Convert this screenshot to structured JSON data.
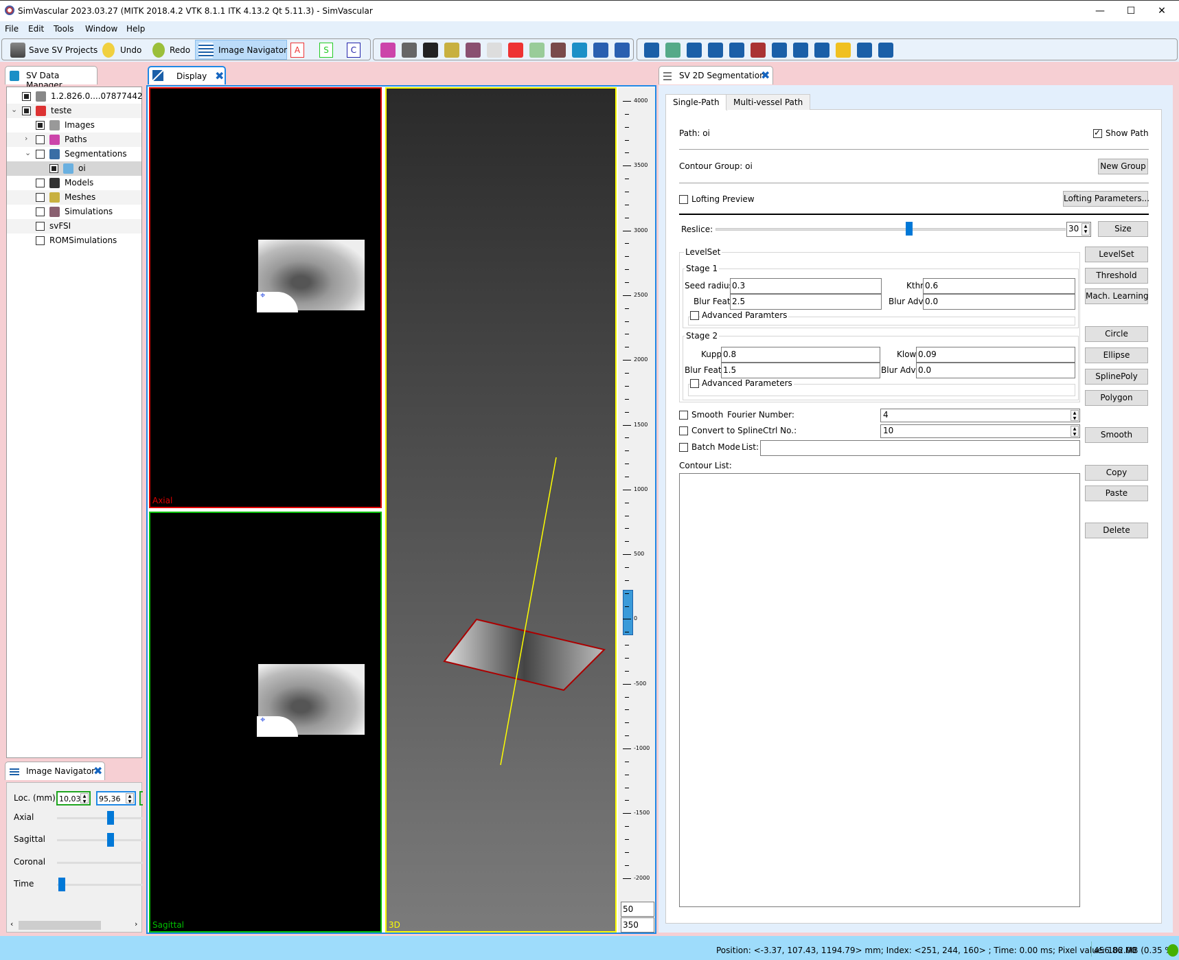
{
  "window": {
    "title": "SimVascular 2023.03.27 (MITK 2018.4.2 VTK 8.1.1 ITK 4.13.2 Qt 5.11.3) - SimVascular",
    "minimize": "—",
    "maximize": "☐",
    "close": "✕"
  },
  "menu": [
    "File",
    "Edit",
    "Tools",
    "Window",
    "Help"
  ],
  "toolbar": {
    "save": "Save SV Projects",
    "undo": "Undo",
    "redo": "Redo",
    "image_navigator": "Image Navigator",
    "axial": "A",
    "sagittal": "S",
    "coronal": "C",
    "tools": [
      "path-icon",
      "segmentation-icon",
      "model-icon",
      "mesh-icon",
      "simulation-icon",
      "branch-icon",
      "color-map-icon",
      "surface-icon",
      "texture-icon",
      "database-icon",
      "pen-icon",
      "wrench-icon",
      "archive-icon",
      "pointset-icon",
      "help-icon",
      "settings-icon",
      "zoom-icon",
      "measure-icon",
      "list-icon",
      "tools-icon",
      "table-icon",
      "python-icon",
      "chart-icon",
      "eye-icon"
    ]
  },
  "data_manager": {
    "tab": "SV Data Manager",
    "items": [
      {
        "label": "1.2.826.0....07877442",
        "checked": "filled",
        "indent": 0
      },
      {
        "label": "teste",
        "checked": "filled",
        "indent": 0,
        "expand": "open"
      },
      {
        "label": "Images",
        "checked": "filled",
        "indent": 1
      },
      {
        "label": "Paths",
        "checked": "empty",
        "indent": 1,
        "expand": "closed"
      },
      {
        "label": "Segmentations",
        "checked": "empty",
        "indent": 1,
        "expand": "open"
      },
      {
        "label": "oi",
        "checked": "filled",
        "indent": 2,
        "selected": true
      },
      {
        "label": "Models",
        "checked": "empty",
        "indent": 1
      },
      {
        "label": "Meshes",
        "checked": "empty",
        "indent": 1
      },
      {
        "label": "Simulations",
        "checked": "empty",
        "indent": 1
      },
      {
        "label": "svFSI",
        "checked": "empty",
        "indent": 1
      },
      {
        "label": "ROMSimulations",
        "checked": "empty",
        "indent": 1
      }
    ]
  },
  "image_navigator": {
    "tab": "Image Navigator",
    "loc_label": "Loc. (mm)",
    "loc_x": "10,03",
    "loc_y": "95,36",
    "axial": "Axial",
    "sagittal": "Sagittal",
    "coronal": "Coronal",
    "time": "Time",
    "axial_pos": 0.62,
    "sagittal_pos": 0.62,
    "time_pos": 0.0
  },
  "display": {
    "tab": "Display",
    "axial_label": "Axial",
    "sagittal_label": "Sagittal",
    "view3d_label": "3D",
    "ruler_labels": [
      "4000",
      "3500",
      "3000",
      "2500",
      "2000",
      "1500",
      "1000",
      "500",
      "0",
      "-500",
      "-1000",
      "-1500",
      "-2000"
    ],
    "level": "50",
    "window": "350",
    "colors": {
      "axial": "#e00000",
      "sagittal": "#00c000",
      "view3d": "#ffff00"
    }
  },
  "segmentation": {
    "tab": "SV 2D Segmentation",
    "tabs": [
      "Single-Path",
      "Multi-vessel Path"
    ],
    "path": "Path: oi",
    "show_path": "Show Path",
    "contour_group": "Contour Group: oi",
    "new_group": "New Group",
    "lofting_preview": "Lofting Preview",
    "lofting_params": "Lofting Parameters...",
    "reslice": "Reslice:",
    "reslice_value": "30",
    "reslice_pos": 0.55,
    "size": "Size",
    "levelset": {
      "title": "LevelSet",
      "stage1": "Stage 1",
      "seed_radius_label": "Seed radius",
      "seed_radius": "0.3",
      "kthr_label": "Kthr",
      "kthr": "0.6",
      "blur_feat_label": "Blur Feat.",
      "blur_feat1": "2.5",
      "blur_adv_label": "Blur Adv.",
      "blur_adv1": "0.0",
      "adv1": "Advanced  Paramters",
      "stage2": "Stage 2",
      "kupp_label": "Kupp",
      "kupp": "0.8",
      "klow_label": "Klow",
      "klow": "0.09",
      "blur_feat2": "1.5",
      "blur_adv2": "0.0",
      "adv2": "Advanced Parameters"
    },
    "buttons": {
      "levelset": "LevelSet",
      "threshold": "Threshold",
      "ml": "Mach. Learning",
      "circle": "Circle",
      "ellipse": "Ellipse",
      "splinepoly": "SplinePoly",
      "polygon": "Polygon",
      "smooth": "Smooth",
      "copy": "Copy",
      "paste": "Paste",
      "delete": "Delete"
    },
    "smooth": "Smooth",
    "fourier_label": "Fourier Number:",
    "fourier": "4",
    "spline": "Convert to Spline",
    "ctrl_label": "Ctrl No.:",
    "ctrl": "10",
    "batch": "Batch Mode",
    "list_label": "List:",
    "batch_list": "",
    "contour_list": "Contour List:"
  },
  "status": {
    "text": "Position: <-3.37, 107.43, 1194.79> mm; Index: <251, 244, 160> ; Time: 0.00 ms; Pixel value: 102.00",
    "memory": "456.86 MB (0.35 %)",
    "indicator_color": "#44b000"
  }
}
